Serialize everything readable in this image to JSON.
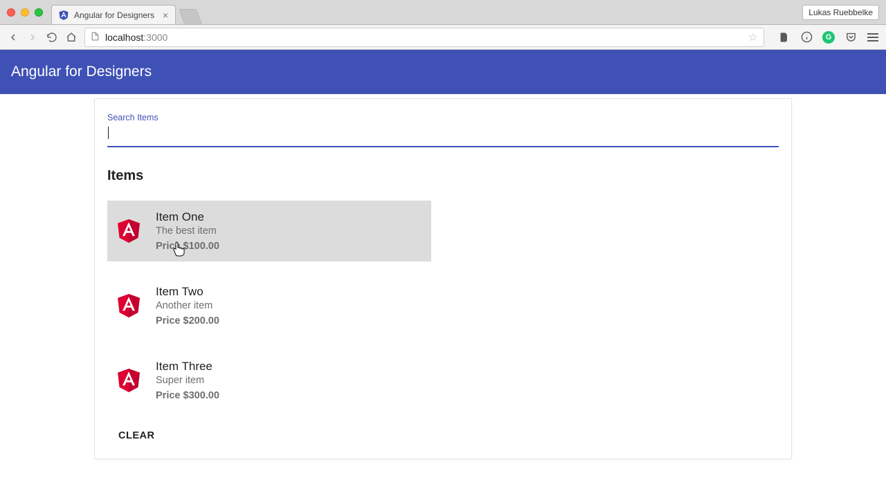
{
  "browser": {
    "tab_title": "Angular for Designers",
    "profile_name": "Lukas Ruebbelke",
    "url_host": "localhost",
    "url_port": ":3000"
  },
  "app": {
    "toolbar_title": "Angular for Designers"
  },
  "search": {
    "label": "Search Items",
    "value": ""
  },
  "items_heading": "Items",
  "items": [
    {
      "title": "Item One",
      "subtitle": "The best item",
      "price_label": "Price $100.00",
      "selected": true
    },
    {
      "title": "Item Two",
      "subtitle": "Another item",
      "price_label": "Price $200.00",
      "selected": false
    },
    {
      "title": "Item Three",
      "subtitle": "Super item",
      "price_label": "Price $300.00",
      "selected": false
    }
  ],
  "clear_label": "CLEAR"
}
